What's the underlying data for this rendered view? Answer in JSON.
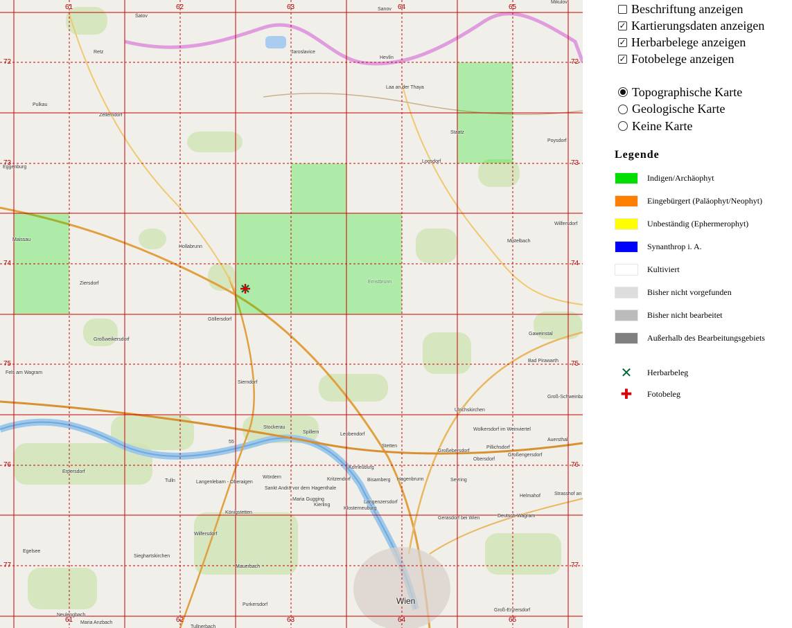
{
  "map": {
    "x_labels": [
      "61",
      "62",
      "63",
      "64",
      "65"
    ],
    "y_labels": [
      "72",
      "73",
      "74",
      "75",
      "76",
      "77"
    ],
    "places": [
      {
        "name": "Šatov",
        "big": false,
        "green": false
      },
      {
        "name": "Sanov",
        "big": false,
        "green": false
      },
      {
        "name": "Mikulov",
        "big": false,
        "green": false
      },
      {
        "name": "Jaroslavice",
        "big": false,
        "green": false
      },
      {
        "name": "Hevlín",
        "big": false,
        "green": false
      },
      {
        "name": "Retz",
        "big": false,
        "green": false
      },
      {
        "name": "Laa an der Thaya",
        "big": false,
        "green": false
      },
      {
        "name": "Pulkau",
        "big": false,
        "green": false
      },
      {
        "name": "Zellerndorf",
        "big": false,
        "green": false
      },
      {
        "name": "Staatz",
        "big": false,
        "green": false
      },
      {
        "name": "Poysdorf",
        "big": false,
        "green": false
      },
      {
        "name": "Eggenburg",
        "big": false,
        "green": false
      },
      {
        "name": "Loosdorf",
        "big": false,
        "green": false
      },
      {
        "name": "Wilfersdorf",
        "big": false,
        "green": false
      },
      {
        "name": "Hollabrunn",
        "big": false,
        "green": false
      },
      {
        "name": "Maissau",
        "big": false,
        "green": false
      },
      {
        "name": "Mistelbach",
        "big": false,
        "green": false
      },
      {
        "name": "Ziersdorf",
        "big": false,
        "green": false
      },
      {
        "name": "Ernstbrunn",
        "big": false,
        "green": true
      },
      {
        "name": "Göllersdorf",
        "big": false,
        "green": false
      },
      {
        "name": "Gaweinstal",
        "big": false,
        "green": false
      },
      {
        "name": "Großweikersdorf",
        "big": false,
        "green": false
      },
      {
        "name": "Bad Pirawarth",
        "big": false,
        "green": false
      },
      {
        "name": "Fels am Wagram",
        "big": false,
        "green": false
      },
      {
        "name": "Sierndorf",
        "big": false,
        "green": false
      },
      {
        "name": "Groß-Schweinbarth",
        "big": false,
        "green": false
      },
      {
        "name": "Ulrichskirchen",
        "big": false,
        "green": false
      },
      {
        "name": "Stockerau",
        "big": false,
        "green": false
      },
      {
        "name": "Spillern",
        "big": false,
        "green": false
      },
      {
        "name": "Leobendorf",
        "big": false,
        "green": false
      },
      {
        "name": "Wolkersdorf im Weinviertel",
        "big": false,
        "green": false
      },
      {
        "name": "Stetten",
        "big": false,
        "green": false
      },
      {
        "name": "Auersthal",
        "big": false,
        "green": false
      },
      {
        "name": "Pillichsdorf",
        "big": false,
        "green": false
      },
      {
        "name": "Großebersdorf",
        "big": false,
        "green": false
      },
      {
        "name": "Obersdorf",
        "big": false,
        "green": false
      },
      {
        "name": "Großengersdorf",
        "big": false,
        "green": false
      },
      {
        "name": "Korneuburg",
        "big": false,
        "green": false
      },
      {
        "name": "Tulln",
        "big": false,
        "green": false
      },
      {
        "name": "Langenlebarn - Oberaigen",
        "big": false,
        "green": false
      },
      {
        "name": "Kritzendorf",
        "big": false,
        "green": false
      },
      {
        "name": "Bisamberg",
        "big": false,
        "green": false
      },
      {
        "name": "Hagenbrunn",
        "big": false,
        "green": false
      },
      {
        "name": "Seyring",
        "big": false,
        "green": false
      },
      {
        "name": "Erpersdorf",
        "big": false,
        "green": false
      },
      {
        "name": "Wördern",
        "big": false,
        "green": false
      },
      {
        "name": "Sankt Andrä vor dem Hagenthale",
        "big": false,
        "green": false
      },
      {
        "name": "Maria Gugging",
        "big": false,
        "green": false
      },
      {
        "name": "Kierling",
        "big": false,
        "green": false
      },
      {
        "name": "Langenzersdorf",
        "big": false,
        "green": false
      },
      {
        "name": "Helmahof",
        "big": false,
        "green": false
      },
      {
        "name": "Strasshof an der",
        "big": false,
        "green": false
      },
      {
        "name": "Klosterneuburg",
        "big": false,
        "green": false
      },
      {
        "name": "Königstetten",
        "big": false,
        "green": false
      },
      {
        "name": "Gerasdorf bei Wien",
        "big": false,
        "green": false
      },
      {
        "name": "Deutsch-Wagram",
        "big": false,
        "green": false
      },
      {
        "name": "Wilfersdorf",
        "big": false,
        "green": false
      },
      {
        "name": "Egelsee",
        "big": false,
        "green": false
      },
      {
        "name": "Sieghartskirchen",
        "big": false,
        "green": false
      },
      {
        "name": "Mauerbach",
        "big": false,
        "green": false
      },
      {
        "name": "Purkersdorf",
        "big": false,
        "green": false
      },
      {
        "name": "Wien",
        "big": true,
        "green": false
      },
      {
        "name": "Groß-Enzersdorf",
        "big": false,
        "green": false
      },
      {
        "name": "Neulengbach",
        "big": false,
        "green": false
      },
      {
        "name": "Maria Anzbach",
        "big": false,
        "green": false
      },
      {
        "name": "Tullnerbach",
        "big": false,
        "green": false
      },
      {
        "name": "55",
        "big": false,
        "green": false
      }
    ]
  },
  "options": {
    "checkboxes": [
      {
        "label": "Beschriftung anzeigen",
        "checked": false
      },
      {
        "label": "Kartierungsdaten anzeigen",
        "checked": true
      },
      {
        "label": "Herbarbelege anzeigen",
        "checked": true
      },
      {
        "label": "Fotobelege anzeigen",
        "checked": true
      }
    ],
    "radios": [
      {
        "label": "Topographische Karte",
        "selected": true
      },
      {
        "label": "Geologische Karte",
        "selected": false
      },
      {
        "label": "Keine Karte",
        "selected": false
      }
    ]
  },
  "legend": {
    "title": "Legende",
    "items": [
      {
        "label": "Indigen/Archäophyt",
        "color": "#00dd00"
      },
      {
        "label": "Eingebürgert (Paläophyt/Neophyt)",
        "color": "#ff8000"
      },
      {
        "label": "Unbeständig (Ephermerophyt)",
        "color": "#ffff00"
      },
      {
        "label": "Synanthrop i. A.",
        "color": "#0000ff"
      },
      {
        "label": "Kultiviert",
        "color": "#ffffff"
      },
      {
        "label": "Bisher nicht vorgefunden",
        "color": "#dddddd"
      },
      {
        "label": "Bisher nicht bearbeitet",
        "color": "#bbbbbb"
      },
      {
        "label": "Außerhalb des Bearbeitungsgebiets",
        "color": "#808080"
      }
    ],
    "symbols": [
      {
        "label": "Herbarbeleg",
        "glyph": "✕",
        "color": "#006633"
      },
      {
        "label": "Fotobeleg",
        "glyph": "✚",
        "color": "#dd0000"
      }
    ]
  }
}
